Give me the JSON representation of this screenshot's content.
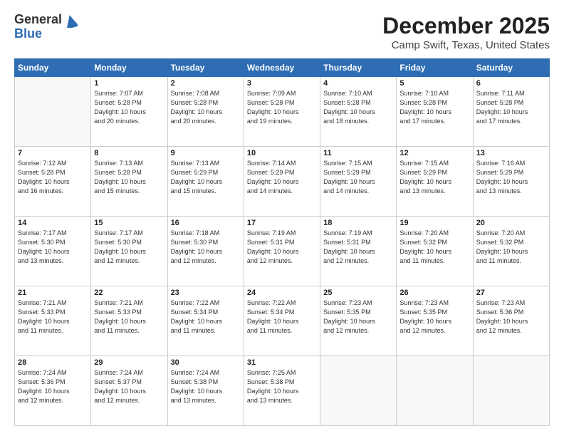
{
  "header": {
    "logo_line1": "General",
    "logo_line2": "Blue",
    "title": "December 2025",
    "subtitle": "Camp Swift, Texas, United States"
  },
  "weekdays": [
    "Sunday",
    "Monday",
    "Tuesday",
    "Wednesday",
    "Thursday",
    "Friday",
    "Saturday"
  ],
  "weeks": [
    [
      {
        "day": "",
        "info": ""
      },
      {
        "day": "1",
        "info": "Sunrise: 7:07 AM\nSunset: 5:28 PM\nDaylight: 10 hours\nand 20 minutes."
      },
      {
        "day": "2",
        "info": "Sunrise: 7:08 AM\nSunset: 5:28 PM\nDaylight: 10 hours\nand 20 minutes."
      },
      {
        "day": "3",
        "info": "Sunrise: 7:09 AM\nSunset: 5:28 PM\nDaylight: 10 hours\nand 19 minutes."
      },
      {
        "day": "4",
        "info": "Sunrise: 7:10 AM\nSunset: 5:28 PM\nDaylight: 10 hours\nand 18 minutes."
      },
      {
        "day": "5",
        "info": "Sunrise: 7:10 AM\nSunset: 5:28 PM\nDaylight: 10 hours\nand 17 minutes."
      },
      {
        "day": "6",
        "info": "Sunrise: 7:11 AM\nSunset: 5:28 PM\nDaylight: 10 hours\nand 17 minutes."
      }
    ],
    [
      {
        "day": "7",
        "info": "Sunrise: 7:12 AM\nSunset: 5:28 PM\nDaylight: 10 hours\nand 16 minutes."
      },
      {
        "day": "8",
        "info": "Sunrise: 7:13 AM\nSunset: 5:28 PM\nDaylight: 10 hours\nand 15 minutes."
      },
      {
        "day": "9",
        "info": "Sunrise: 7:13 AM\nSunset: 5:29 PM\nDaylight: 10 hours\nand 15 minutes."
      },
      {
        "day": "10",
        "info": "Sunrise: 7:14 AM\nSunset: 5:29 PM\nDaylight: 10 hours\nand 14 minutes."
      },
      {
        "day": "11",
        "info": "Sunrise: 7:15 AM\nSunset: 5:29 PM\nDaylight: 10 hours\nand 14 minutes."
      },
      {
        "day": "12",
        "info": "Sunrise: 7:15 AM\nSunset: 5:29 PM\nDaylight: 10 hours\nand 13 minutes."
      },
      {
        "day": "13",
        "info": "Sunrise: 7:16 AM\nSunset: 5:29 PM\nDaylight: 10 hours\nand 13 minutes."
      }
    ],
    [
      {
        "day": "14",
        "info": "Sunrise: 7:17 AM\nSunset: 5:30 PM\nDaylight: 10 hours\nand 13 minutes."
      },
      {
        "day": "15",
        "info": "Sunrise: 7:17 AM\nSunset: 5:30 PM\nDaylight: 10 hours\nand 12 minutes."
      },
      {
        "day": "16",
        "info": "Sunrise: 7:18 AM\nSunset: 5:30 PM\nDaylight: 10 hours\nand 12 minutes."
      },
      {
        "day": "17",
        "info": "Sunrise: 7:19 AM\nSunset: 5:31 PM\nDaylight: 10 hours\nand 12 minutes."
      },
      {
        "day": "18",
        "info": "Sunrise: 7:19 AM\nSunset: 5:31 PM\nDaylight: 10 hours\nand 12 minutes."
      },
      {
        "day": "19",
        "info": "Sunrise: 7:20 AM\nSunset: 5:32 PM\nDaylight: 10 hours\nand 11 minutes."
      },
      {
        "day": "20",
        "info": "Sunrise: 7:20 AM\nSunset: 5:32 PM\nDaylight: 10 hours\nand 11 minutes."
      }
    ],
    [
      {
        "day": "21",
        "info": "Sunrise: 7:21 AM\nSunset: 5:33 PM\nDaylight: 10 hours\nand 11 minutes."
      },
      {
        "day": "22",
        "info": "Sunrise: 7:21 AM\nSunset: 5:33 PM\nDaylight: 10 hours\nand 11 minutes."
      },
      {
        "day": "23",
        "info": "Sunrise: 7:22 AM\nSunset: 5:34 PM\nDaylight: 10 hours\nand 11 minutes."
      },
      {
        "day": "24",
        "info": "Sunrise: 7:22 AM\nSunset: 5:34 PM\nDaylight: 10 hours\nand 11 minutes."
      },
      {
        "day": "25",
        "info": "Sunrise: 7:23 AM\nSunset: 5:35 PM\nDaylight: 10 hours\nand 12 minutes."
      },
      {
        "day": "26",
        "info": "Sunrise: 7:23 AM\nSunset: 5:35 PM\nDaylight: 10 hours\nand 12 minutes."
      },
      {
        "day": "27",
        "info": "Sunrise: 7:23 AM\nSunset: 5:36 PM\nDaylight: 10 hours\nand 12 minutes."
      }
    ],
    [
      {
        "day": "28",
        "info": "Sunrise: 7:24 AM\nSunset: 5:36 PM\nDaylight: 10 hours\nand 12 minutes."
      },
      {
        "day": "29",
        "info": "Sunrise: 7:24 AM\nSunset: 5:37 PM\nDaylight: 10 hours\nand 12 minutes."
      },
      {
        "day": "30",
        "info": "Sunrise: 7:24 AM\nSunset: 5:38 PM\nDaylight: 10 hours\nand 13 minutes."
      },
      {
        "day": "31",
        "info": "Sunrise: 7:25 AM\nSunset: 5:38 PM\nDaylight: 10 hours\nand 13 minutes."
      },
      {
        "day": "",
        "info": ""
      },
      {
        "day": "",
        "info": ""
      },
      {
        "day": "",
        "info": ""
      }
    ]
  ]
}
